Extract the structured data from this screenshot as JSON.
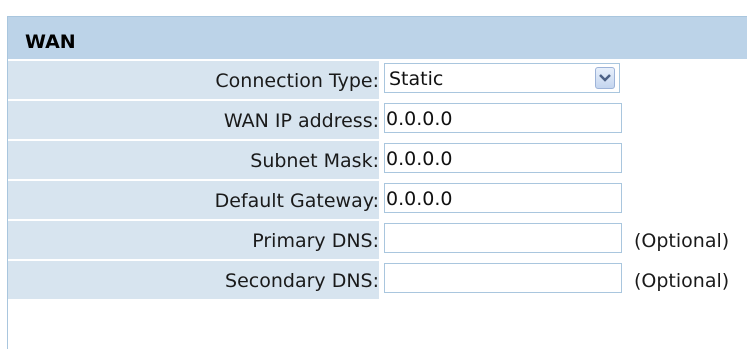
{
  "section": {
    "title": "WAN"
  },
  "connection_type": {
    "label": "Connection Type:",
    "selected": "Static",
    "arrow_icon": "chevron-down-icon"
  },
  "wan_ip": {
    "label": "WAN IP address:",
    "value": "0.0.0.0"
  },
  "subnet_mask": {
    "label": "Subnet Mask:",
    "value": "0.0.0.0"
  },
  "default_gateway": {
    "label": "Default Gateway:",
    "value": "0.0.0.0"
  },
  "primary_dns": {
    "label": "Primary DNS:",
    "value": "",
    "note": "(Optional)"
  },
  "secondary_dns": {
    "label": "Secondary DNS:",
    "value": "",
    "note": "(Optional)"
  },
  "colors": {
    "header_bg": "#bcd3e8",
    "label_bg": "#d7e4ef",
    "border": "#a9c6de"
  }
}
